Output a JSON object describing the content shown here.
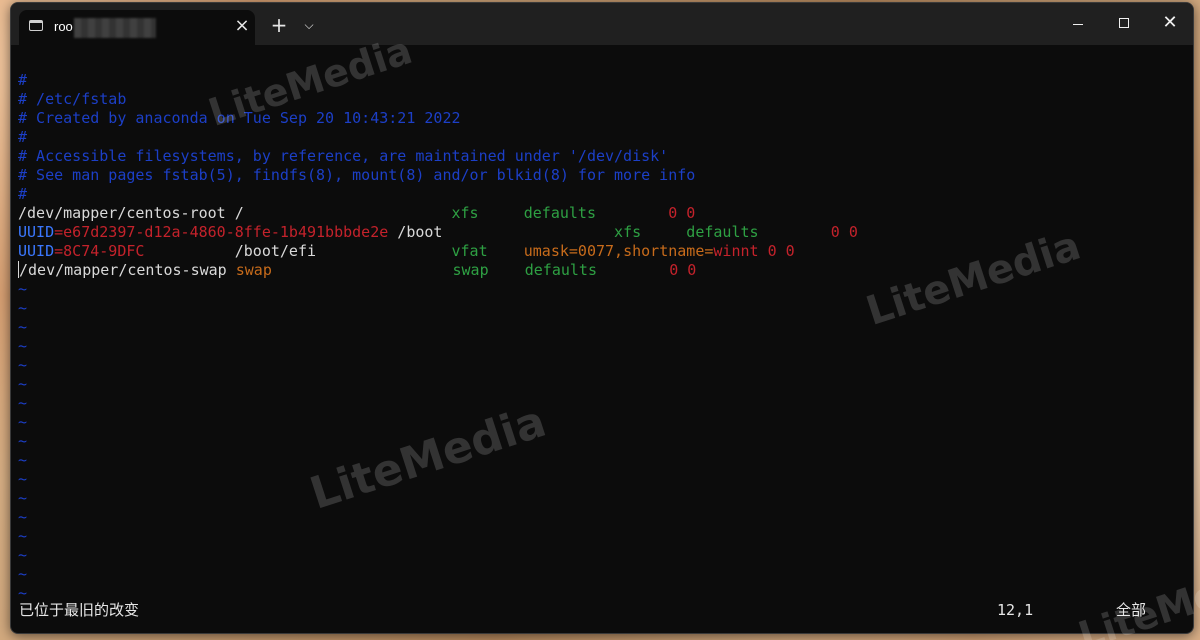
{
  "window": {
    "tab_title": "roo",
    "tab_close_glyph": "×",
    "new_tab_glyph": "+",
    "tab_dropdown_glyph": "⌵",
    "close_glyph": "✕"
  },
  "editor": {
    "lines": [
      [
        {
          "t": "#",
          "c": "cmt"
        }
      ],
      [
        {
          "t": "# /etc/fstab",
          "c": "cmt"
        }
      ],
      [
        {
          "t": "# Created by anaconda on Tue Sep 20 10:43:21 2022",
          "c": "cmt"
        }
      ],
      [
        {
          "t": "#",
          "c": "cmt"
        }
      ],
      [
        {
          "t": "# Accessible filesystems, by reference, are maintained under '/dev/disk'",
          "c": "cmt"
        }
      ],
      [
        {
          "t": "# See man pages fstab(5), findfs(8), mount(8) and/or blkid(8) for more info",
          "c": "cmt"
        }
      ],
      [
        {
          "t": "#",
          "c": "cmt"
        }
      ],
      [
        {
          "t": "/dev/mapper/centos-root /                       ",
          "c": "white"
        },
        {
          "t": "xfs",
          "c": "green"
        },
        {
          "t": "     ",
          "c": "white"
        },
        {
          "t": "defaults",
          "c": "green"
        },
        {
          "t": "        ",
          "c": "white"
        },
        {
          "t": "0 0",
          "c": "red"
        }
      ],
      [
        {
          "t": "UUID",
          "c": "blue"
        },
        {
          "t": "=",
          "c": "red"
        },
        {
          "t": "e67d2397-d12a-4860-8ffe-1b491bbbde2e",
          "c": "red"
        },
        {
          "t": " /boot                   ",
          "c": "white"
        },
        {
          "t": "xfs",
          "c": "green"
        },
        {
          "t": "     ",
          "c": "white"
        },
        {
          "t": "defaults",
          "c": "green"
        },
        {
          "t": "        ",
          "c": "white"
        },
        {
          "t": "0 0",
          "c": "red"
        }
      ],
      [
        {
          "t": "UUID",
          "c": "blue"
        },
        {
          "t": "=",
          "c": "red"
        },
        {
          "t": "8C74-9DFC",
          "c": "red"
        },
        {
          "t": "          /boot/efi               ",
          "c": "white"
        },
        {
          "t": "vfat",
          "c": "green"
        },
        {
          "t": "    ",
          "c": "white"
        },
        {
          "t": "umask=0077,shortname=",
          "c": "orange"
        },
        {
          "t": "winnt",
          "c": "red"
        },
        {
          "t": " ",
          "c": "white"
        },
        {
          "t": "0 0",
          "c": "red"
        }
      ],
      [
        {
          "t": "/dev/mapper/centos-swap ",
          "c": "white"
        },
        {
          "t": "swap",
          "c": "orange"
        },
        {
          "t": "                    ",
          "c": "white"
        },
        {
          "t": "swap",
          "c": "green"
        },
        {
          "t": "    ",
          "c": "white"
        },
        {
          "t": "defaults",
          "c": "green"
        },
        {
          "t": "        ",
          "c": "white"
        },
        {
          "t": "0 0",
          "c": "red"
        }
      ]
    ],
    "cursor_line": 10,
    "tilde_char": "~",
    "tilde_count": 17
  },
  "status": {
    "message": "已位于最旧的改变",
    "position": "12,1",
    "scroll": "全部"
  },
  "watermark": {
    "text": "LiteMedia"
  },
  "colors": {
    "comment": "#1c3fc7",
    "green": "#2ea043",
    "red": "#c4222b",
    "blue": "#3b78ff",
    "orange": "#c76b1b",
    "foreground": "#d9d9d9",
    "background": "#0c0c0c"
  }
}
